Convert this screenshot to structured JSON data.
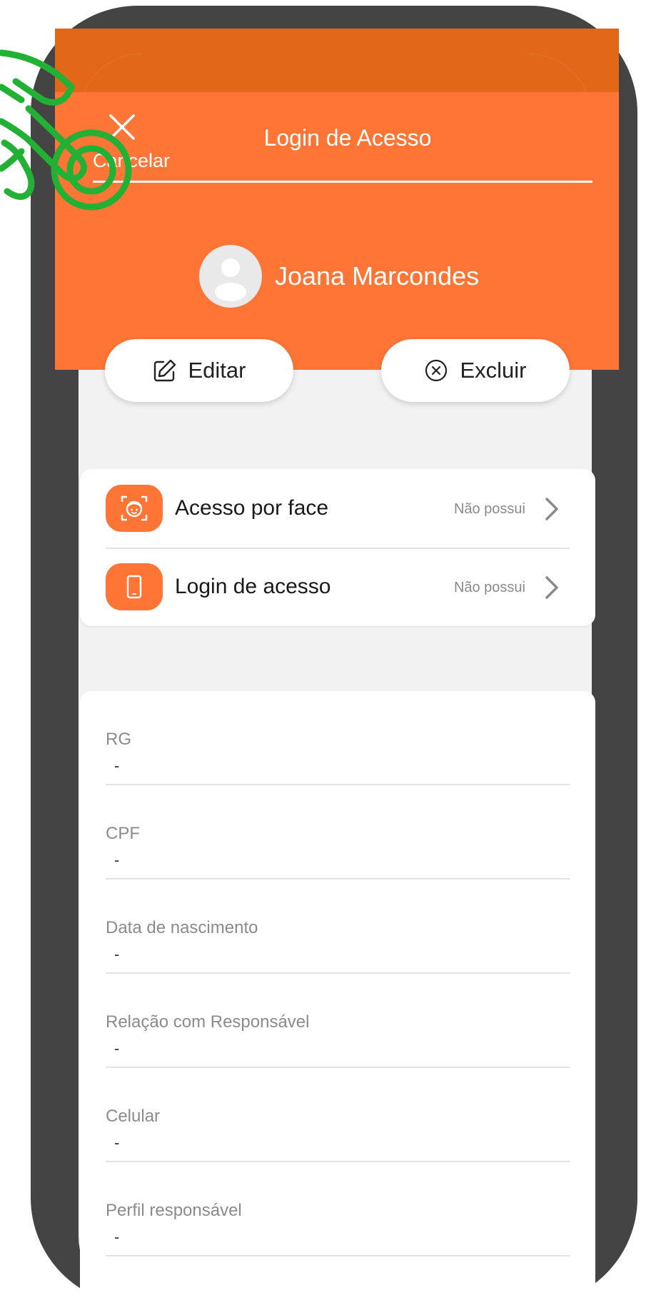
{
  "header": {
    "cancel_label": "Cancelar",
    "title": "Login de Acesso",
    "user_name": "Joana Marcondes"
  },
  "actions": {
    "edit_label": "Editar",
    "delete_label": "Excluir"
  },
  "access_items": [
    {
      "label": "Acesso por face",
      "status": "Não possui",
      "icon": "face-scan-icon"
    },
    {
      "label": "Login de acesso",
      "status": "Não possui",
      "icon": "smartphone-icon"
    }
  ],
  "info_fields": [
    {
      "label": "RG",
      "value": "-"
    },
    {
      "label": "CPF",
      "value": "-"
    },
    {
      "label": "Data de nascimento",
      "value": "-"
    },
    {
      "label": "Relação com Responsável",
      "value": "-"
    },
    {
      "label": "Celular",
      "value": "-"
    },
    {
      "label": "Perfil responsável",
      "value": "-"
    }
  ],
  "colors": {
    "accent": "#ff7535",
    "accent_dark": "#e06818",
    "phone_frame": "#444444",
    "tap_indicator": "#22b035"
  }
}
